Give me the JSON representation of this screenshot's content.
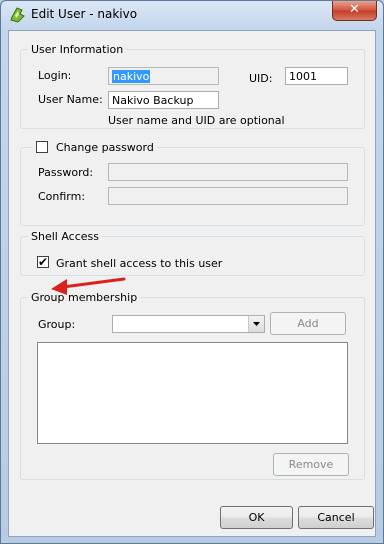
{
  "window": {
    "title": "Edit User - nakivo",
    "close_glyph": "✕"
  },
  "user_info": {
    "legend": "User Information",
    "login_label": "Login:",
    "login_value": "nakivo",
    "uid_label": "UID:",
    "uid_value": "1001",
    "username_label": "User Name:",
    "username_value": "Nakivo Backup",
    "hint": "User name and UID are optional"
  },
  "password": {
    "legend": "Change password",
    "checked": false,
    "password_label": "Password:",
    "confirm_label": "Confirm:"
  },
  "shell": {
    "legend": "Shell Access",
    "grant_label": "Grant shell access to this user",
    "checked": true,
    "check_glyph": "✔"
  },
  "group": {
    "legend": "Group membership",
    "group_label": "Group:",
    "group_value": "",
    "add_label": "Add",
    "remove_label": "Remove"
  },
  "buttons": {
    "ok": "OK",
    "cancel": "Cancel"
  },
  "colors": {
    "annotation_arrow": "#d9221e",
    "selection": "#3399ff"
  }
}
